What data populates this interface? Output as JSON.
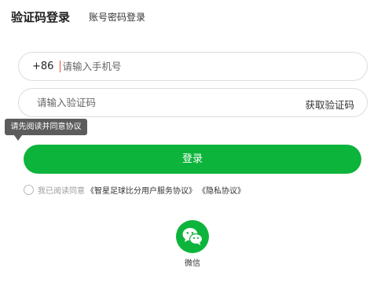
{
  "tabs": {
    "sms_login": "验证码登录",
    "password_login": "账号密码登录"
  },
  "phone": {
    "country_code": "+86",
    "placeholder": "请输入手机号"
  },
  "code": {
    "placeholder": "请输入验证码",
    "get_code_label": "获取验证码"
  },
  "tooltip": "请先阅读并同意协议",
  "login_button": "登录",
  "agreement": {
    "prefix": "我已阅读同意",
    "service_link": "《智星足球比分用户服务协议》",
    "privacy_link": "《隐私协议》"
  },
  "social": {
    "wechat_label": "微信",
    "wechat_icon": "wechat-icon",
    "brand_color": "#0db43b"
  }
}
